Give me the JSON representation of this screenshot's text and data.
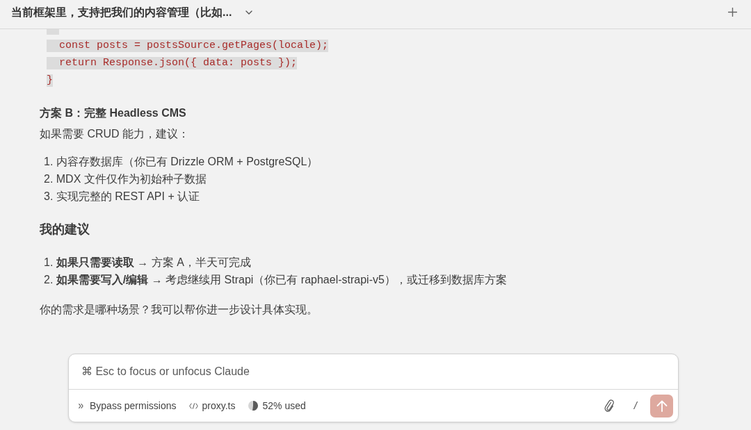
{
  "header": {
    "title": "当前框架里，支持把我们的内容管理（比如..."
  },
  "code_block": {
    "lines": [
      "  const posts = postsSource.getPages(locale);",
      "  return Response.json({ data: posts });",
      "}"
    ]
  },
  "message": [
    {
      "kind": "subheading",
      "text": "方案 B：完整 Headless CMS"
    },
    {
      "kind": "paragraph",
      "text": "如果需要 CRUD 能力，建议："
    },
    {
      "kind": "list",
      "items": [
        "1. 内容存数据库（你已有 Drizzle ORM + PostgreSQL）",
        "2. MDX 文件仅作为初始种子数据",
        "3. 实现完整的 REST API + 认证"
      ]
    },
    {
      "kind": "heading",
      "text": "我的建议"
    },
    {
      "kind": "list",
      "items": [
        "1. **如果只需要读取** → 方案 A，半天可完成",
        "2. **如果需要写入/编辑** → 考虑继续用 Strapi（你已有 raphael-strapi-v5），或迁移到数据库方案"
      ]
    },
    {
      "kind": "paragraph",
      "text": "你的需求是哪种场景？我可以帮你进一步设计具体实现。"
    }
  ],
  "composer": {
    "placeholder": "⌘ Esc to focus or unfocus Claude",
    "permission_mode": "Bypass permissions",
    "file": "proxy.ts",
    "context": {
      "level": 0.52,
      "reading": "52% used"
    },
    "slash_command": "/"
  }
}
